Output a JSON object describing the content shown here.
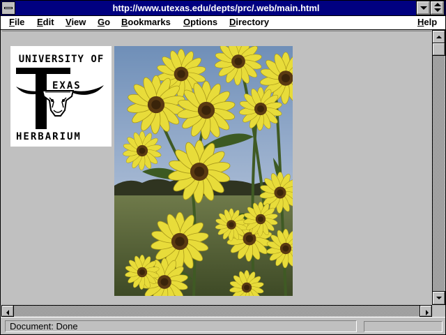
{
  "window": {
    "title": "http://www.utexas.edu/depts/prc/.web/main.html"
  },
  "menu": {
    "items": [
      {
        "key": "F",
        "rest": "ile"
      },
      {
        "key": "E",
        "rest": "dit"
      },
      {
        "key": "V",
        "rest": "iew"
      },
      {
        "key": "G",
        "rest": "o"
      },
      {
        "key": "B",
        "rest": "ookmarks"
      },
      {
        "key": "O",
        "rest": "ptions"
      },
      {
        "key": "D",
        "rest": "irectory"
      },
      {
        "key": "H",
        "rest": "elp"
      }
    ]
  },
  "logo": {
    "line1": "UNIVERSITY OF",
    "letter": "T",
    "line2": "EXAS",
    "line3": "HERBARIUM"
  },
  "photo": {
    "subject": "yellow-sunflowers"
  },
  "status": {
    "text": "Document: Done",
    "progress": 0
  },
  "colors": {
    "titlebar": "#000080",
    "chrome": "#c0c0c0",
    "petal": "#e8dc3a",
    "sky": "#8aa4c8"
  }
}
